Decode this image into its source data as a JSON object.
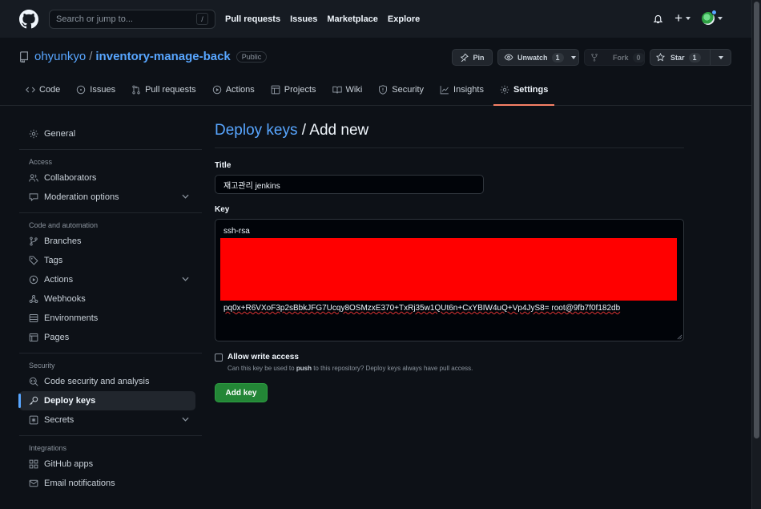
{
  "header": {
    "search_placeholder": "Search or jump to...",
    "search_shortcut": "/",
    "nav": [
      "Pull requests",
      "Issues",
      "Marketplace",
      "Explore"
    ],
    "new_label": "+"
  },
  "repo": {
    "owner": "ohyunkyo",
    "separator": "/",
    "name": "inventory-manage-back",
    "visibility": "Public",
    "pin_label": "Pin",
    "unwatch_label": "Unwatch",
    "watch_count": "1",
    "fork_label": "Fork",
    "fork_count": "0",
    "star_label": "Star",
    "star_count": "1"
  },
  "tabs": [
    "Code",
    "Issues",
    "Pull requests",
    "Actions",
    "Projects",
    "Wiki",
    "Security",
    "Insights",
    "Settings"
  ],
  "sidebar": {
    "general": "General",
    "access_heading": "Access",
    "collaborators": "Collaborators",
    "moderation": "Moderation options",
    "code_heading": "Code and automation",
    "branches": "Branches",
    "tags": "Tags",
    "actions": "Actions",
    "webhooks": "Webhooks",
    "environments": "Environments",
    "pages": "Pages",
    "security_heading": "Security",
    "code_security": "Code security and analysis",
    "deploy_keys": "Deploy keys",
    "secrets": "Secrets",
    "integrations_heading": "Integrations",
    "github_apps": "GitHub apps",
    "email_notifications": "Email notifications"
  },
  "form": {
    "breadcrumb": "Deploy keys",
    "title_suffix": "/ Add new",
    "title_label": "Title",
    "title_value": "재고관리 jenkins",
    "key_label": "Key",
    "key_line1": "ssh-rsa",
    "key_line_last": "pq0x+R6VXoF3p2sBbkJFG7Ucqy8OSMzxE370+TxRj35w1QUt6n+CxYBIW4uQ+Vp4JyS8= root@9fb7f0f182db",
    "allow_write_label": "Allow write access",
    "allow_write_note_pre": "Can this key be used to",
    "allow_write_note_bold": "push",
    "allow_write_note_post": "to this repository? Deploy keys always have pull access.",
    "submit_label": "Add key"
  },
  "colors": {
    "accent": "#58a6ff",
    "tab_underline": "#f78166",
    "primary_button": "#238636",
    "redaction": "#ff0000"
  }
}
